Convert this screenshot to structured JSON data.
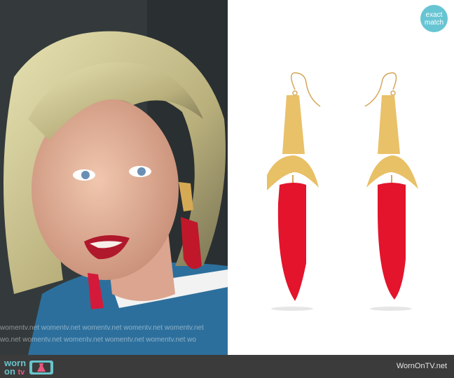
{
  "photo": {
    "watermark_rows": [
      "womentv.net   womentv.net   womentv.net   womentv.net   womentv.net",
      "wo.net   womentv.net   womentv.net   womentv.net   womentv.net   wo"
    ]
  },
  "badge": {
    "line1": "exact",
    "line2": "match",
    "color": "#67c5d3"
  },
  "footer": {
    "logo_word_1": "worn",
    "logo_word_2": "on",
    "logo_word_3": "tv",
    "site": "WornOnTV.net"
  },
  "colors": {
    "footer_bg": "#3b3b3b",
    "earring_red": "#e3142c",
    "earring_gold": "#e9c168"
  }
}
